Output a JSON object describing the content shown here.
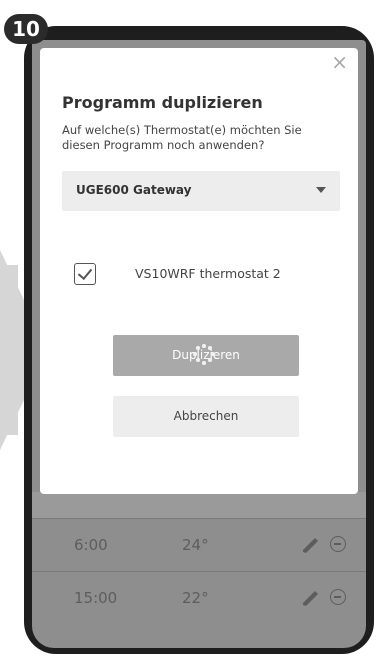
{
  "step": {
    "number": "10"
  },
  "modal": {
    "close_label": "×",
    "title": "Programm duplizieren",
    "subtitle": "Auf welche(s) Thermostat(e) möchten Sie diesen Programm noch anwenden?",
    "select": {
      "value": "UGE600 Gateway"
    },
    "checkbox": {
      "checked": true,
      "label": "VS10WRF thermostat 2"
    },
    "duplicate_label": "Duplizieren",
    "cancel_label": "Abbrechen"
  },
  "background": {
    "rows": [
      {
        "time": "6:00",
        "temp": "24°"
      },
      {
        "time": "15:00",
        "temp": "22°"
      }
    ]
  },
  "colors": {
    "overlay": "#8e8e8e",
    "button_disabled": "#a9a9a9",
    "button_secondary": "#ededed"
  }
}
